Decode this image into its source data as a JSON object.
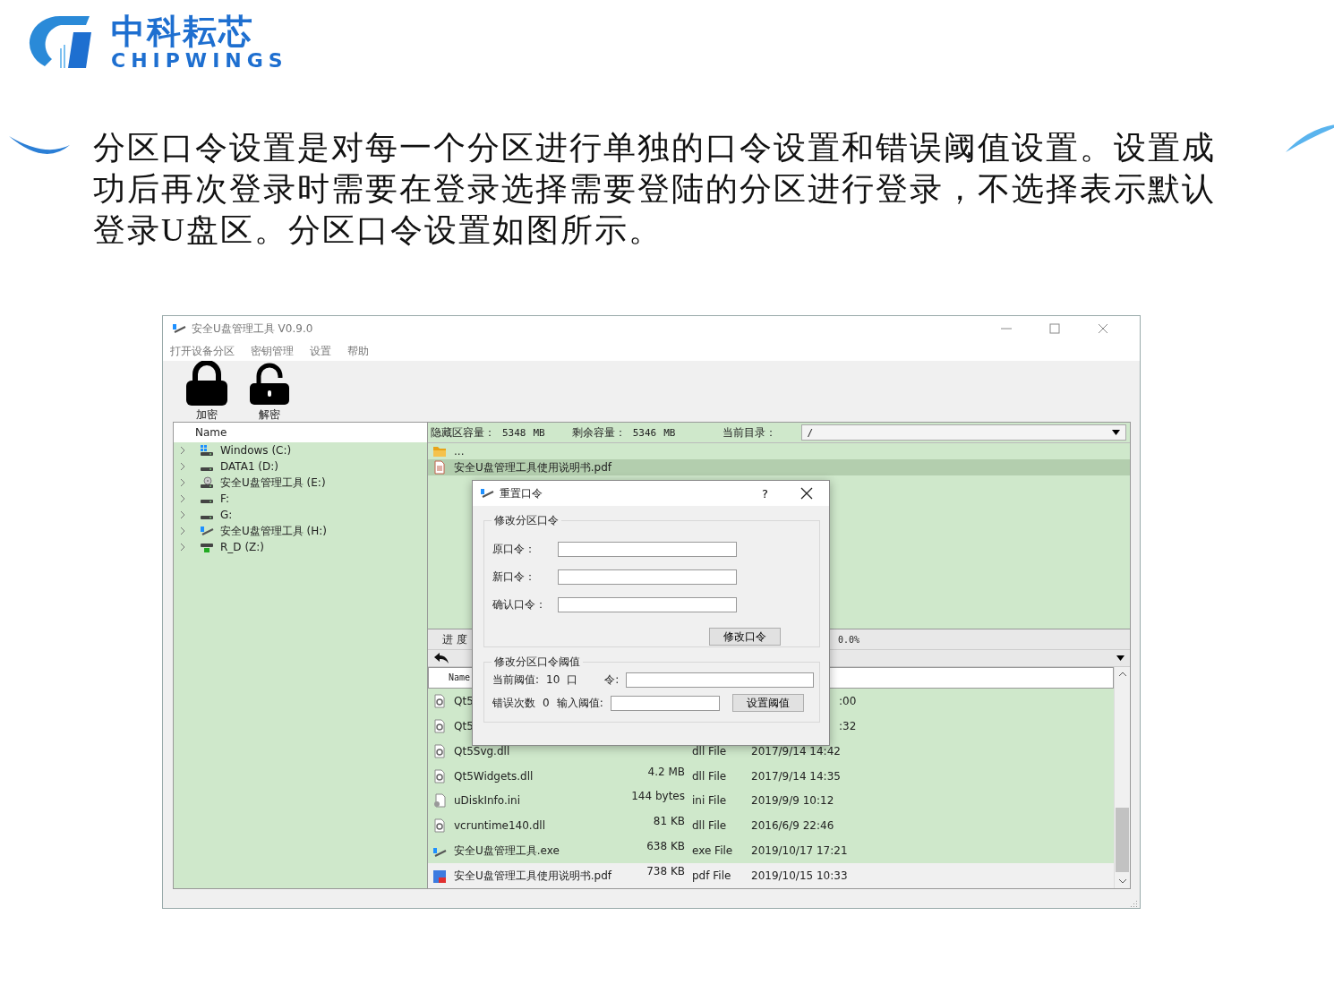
{
  "logo": {
    "name": "中科耘芯",
    "tagline": "CHIPWINGS"
  },
  "intro": "分区口令设置是对每一个分区进行单独的口令设置和错误阈值设置。设置成功后再次登录时需要在登录选择需要登陆的分区进行登录，不选择表示默认登录U盘区。分区口令设置如图所示。",
  "window": {
    "title": "安全U盘管理工具 V0.9.0",
    "menu": [
      "打开设备分区",
      "密钥管理",
      "设置",
      "帮助"
    ],
    "toolbar": [
      {
        "label": "加密",
        "kind": "lock"
      },
      {
        "label": "解密",
        "kind": "unlock"
      }
    ],
    "tree": {
      "header": "Name",
      "items": [
        {
          "label": "Windows (C:)",
          "kind": "system",
          "expanded": false
        },
        {
          "label": "DATA1 (D:)",
          "kind": "drive",
          "expanded": false
        },
        {
          "label": "安全U盘管理工具 (E:)",
          "kind": "disc",
          "expanded": false
        },
        {
          "label": "F:",
          "kind": "drive",
          "expanded": false
        },
        {
          "label": "G:",
          "kind": "drive",
          "expanded": false
        },
        {
          "label": "安全U盘管理工具 (H:)",
          "kind": "app",
          "expanded": false
        },
        {
          "label": "R_D (Z:)",
          "kind": "network",
          "expanded": false
        }
      ]
    },
    "info": {
      "capacity_label": "隐藏区容量：",
      "capacity": "5348",
      "capacity_unit": "MB",
      "free_label": "剩余容量：",
      "free": "5346",
      "free_unit": "MB",
      "dir_label": "当前目录：",
      "dir": "/"
    },
    "files": [
      {
        "name": "...",
        "kind": "folder",
        "selected": false
      },
      {
        "name": "安全U盘管理工具使用说明书.pdf",
        "kind": "document",
        "selected": true
      }
    ],
    "progress": {
      "label": "进 度",
      "reading": "0.0%"
    },
    "list": {
      "header": "Name",
      "rows": [
        {
          "name": "Qt5",
          "size": "",
          "type": "",
          "date": ":00",
          "kind": "dll",
          "covered": true,
          "selected": true
        },
        {
          "name": "Qt5",
          "size": "",
          "type": "",
          "date": ":32",
          "kind": "dll",
          "covered": true,
          "selected": true
        },
        {
          "name": "Qt5Svg.dll",
          "size": "",
          "type": "dll File",
          "date": "2017/9/14 14:42",
          "kind": "dll",
          "covered": false,
          "selected": true
        },
        {
          "name": "Qt5Widgets.dll",
          "size": "4.2 MB",
          "type": "dll File",
          "date": "2017/9/14 14:35",
          "kind": "dll",
          "covered": false,
          "selected": true
        },
        {
          "name": "uDiskInfo.ini",
          "size": "144 bytes",
          "type": "ini File",
          "date": "2019/9/9 10:12",
          "kind": "ini",
          "covered": false,
          "selected": true
        },
        {
          "name": "vcruntime140.dll",
          "size": "81 KB",
          "type": "dll File",
          "date": "2016/6/9 22:46",
          "kind": "dll",
          "covered": false,
          "selected": true
        },
        {
          "name": "安全U盘管理工具.exe",
          "size": "638 KB",
          "type": "exe File",
          "date": "2019/10/17 17:21",
          "kind": "app",
          "covered": false,
          "selected": true
        },
        {
          "name": "安全U盘管理工具使用说明书.pdf",
          "size": "738 KB",
          "type": "pdf File",
          "date": "2019/10/15 10:33",
          "kind": "pdf",
          "covered": false,
          "selected": false
        }
      ]
    },
    "dialog": {
      "title": "重置口令",
      "help": "?",
      "password_group": {
        "title": "修改分区口令",
        "fields": [
          {
            "label": "原口令："
          },
          {
            "label": "新口令："
          },
          {
            "label": "确认口令："
          }
        ],
        "button": "修改口令"
      },
      "threshold_group": {
        "title": "修改分区口令阈值",
        "current_label": "当前阈值:",
        "current": "10",
        "current_unit": "口",
        "password_label": "令:",
        "errors_label": "错误次数",
        "errors": "0",
        "input_label": "输入阈值:",
        "button": "设置阈值"
      }
    }
  }
}
